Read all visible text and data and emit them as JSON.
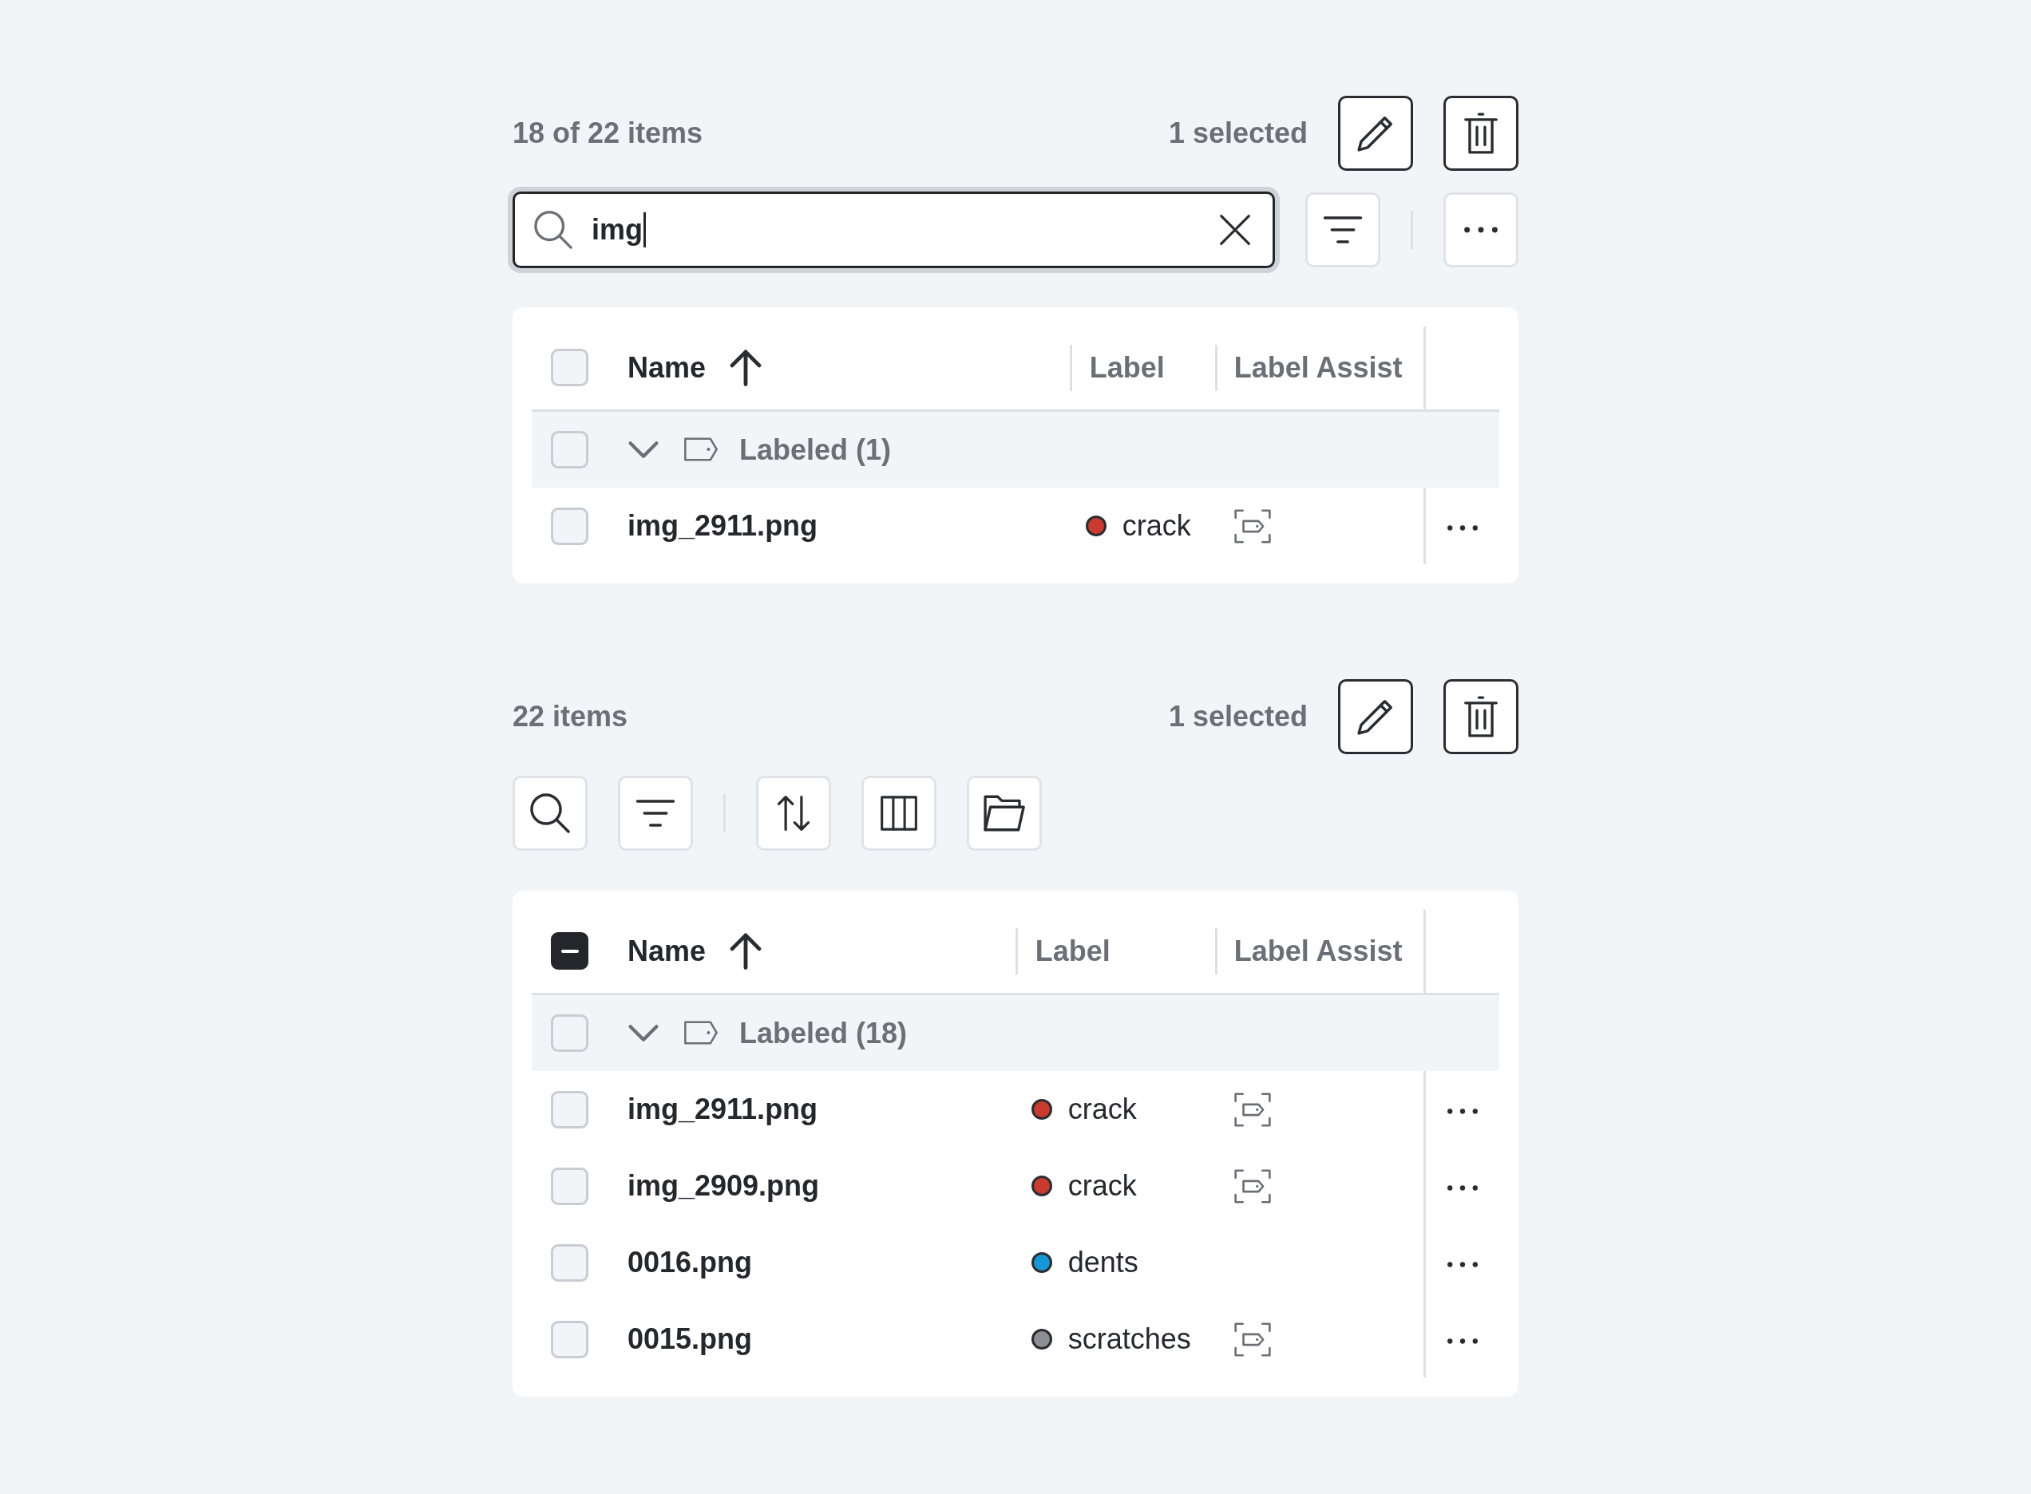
{
  "panels": [
    {
      "item_count": "18 of 22 items",
      "selection": "1 selected",
      "actions": [
        {
          "kind": "edit"
        },
        {
          "kind": "delete"
        }
      ],
      "toolbar": [
        {
          "kind": "search_field",
          "value": "img",
          "focused": true
        },
        {
          "kind": "filter"
        },
        {
          "kind": "divider"
        },
        {
          "kind": "more"
        }
      ],
      "table": {
        "select_all": {
          "checked": false,
          "indeterminate": false
        },
        "columns": [
          {
            "label": "Name",
            "sorted": true
          },
          {
            "label": "Label",
            "sorted": false
          },
          {
            "label": "Label Assist",
            "sorted": false
          }
        ],
        "groups": [
          {
            "label": "Labeled (1)",
            "expanded": true,
            "checked": false,
            "rows": [
              {
                "name": "img_2911.png",
                "checked": false,
                "label": "crack",
                "color": "#c93b2f",
                "label_assist": true
              }
            ]
          }
        ]
      }
    },
    {
      "item_count": "22 items",
      "selection": "1 selected",
      "actions": [
        {
          "kind": "edit"
        },
        {
          "kind": "delete"
        }
      ],
      "toolbar": [
        {
          "kind": "search"
        },
        {
          "kind": "filter"
        },
        {
          "kind": "divider"
        },
        {
          "kind": "sort"
        },
        {
          "kind": "columns"
        },
        {
          "kind": "folder"
        }
      ],
      "table": {
        "select_all": {
          "checked": false,
          "indeterminate": true
        },
        "columns": [
          {
            "label": "Name",
            "sorted": true
          },
          {
            "label": "Label",
            "sorted": false
          },
          {
            "label": "Label Assist",
            "sorted": false
          }
        ],
        "groups": [
          {
            "label": "Labeled (18)",
            "expanded": true,
            "checked": false,
            "rows": [
              {
                "name": "img_2911.png",
                "checked": false,
                "label": "crack",
                "color": "#c93b2f",
                "label_assist": true
              },
              {
                "name": "img_2909.png",
                "checked": false,
                "label": "crack",
                "color": "#c93b2f",
                "label_assist": true
              },
              {
                "name": "0016.png",
                "checked": false,
                "label": "dents",
                "color": "#1598d5",
                "label_assist": false
              },
              {
                "name": "0015.png",
                "checked": false,
                "label": "scratches",
                "color": "#8d8f95",
                "label_assist": true
              }
            ]
          }
        ]
      }
    }
  ]
}
